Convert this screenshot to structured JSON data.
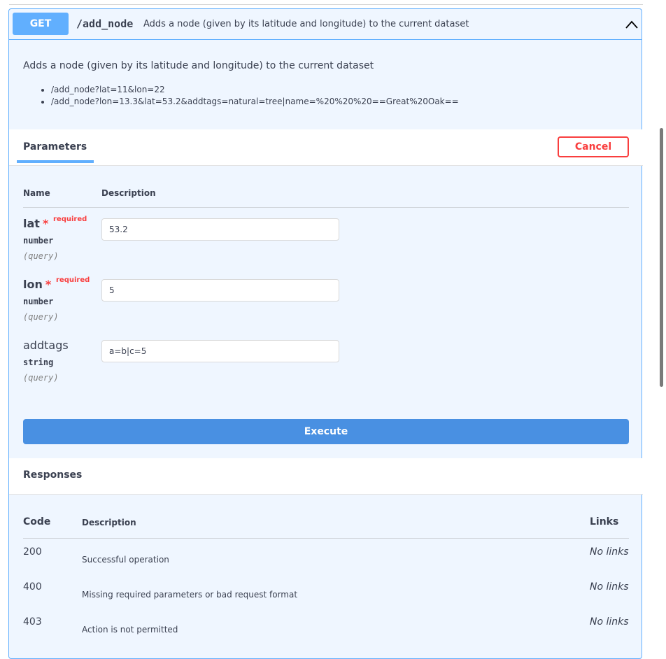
{
  "operation": {
    "method": "GET",
    "path": "/add_node",
    "summary": "Adds a node (given by its latitude and longitude) to the current dataset",
    "description": "Adds a node (given by its latitude and longitude) to the current dataset",
    "examples": [
      "/add_node?lat=11&lon=22",
      "/add_node?lon=13.3&lat=53.2&addtags=natural=tree|name=%20%20%20==Great%20Oak=="
    ],
    "collapse_icon": "chevron-up-icon"
  },
  "parameters": {
    "title": "Parameters",
    "cancel_label": "Cancel",
    "col_name": "Name",
    "col_description": "Description",
    "required_marker": "*",
    "required_label": "required",
    "items": [
      {
        "name": "lat",
        "required": true,
        "type": "number",
        "in": "(query)",
        "value": "53.2"
      },
      {
        "name": "lon",
        "required": true,
        "type": "number",
        "in": "(query)",
        "value": "5"
      },
      {
        "name": "addtags",
        "required": false,
        "type": "string",
        "in": "(query)",
        "value": "a=b|c=5"
      }
    ],
    "execute_label": "Execute"
  },
  "responses": {
    "title": "Responses",
    "col_code": "Code",
    "col_description": "Description",
    "col_links": "Links",
    "items": [
      {
        "code": "200",
        "description": "Successful operation",
        "links": "No links"
      },
      {
        "code": "400",
        "description": "Missing required parameters or bad request format",
        "links": "No links"
      },
      {
        "code": "403",
        "description": "Action is not permitted",
        "links": "No links"
      }
    ]
  },
  "colors": {
    "get_accent": "#61affe",
    "cancel_red": "#f93e3e",
    "execute_blue": "#4990e2"
  }
}
